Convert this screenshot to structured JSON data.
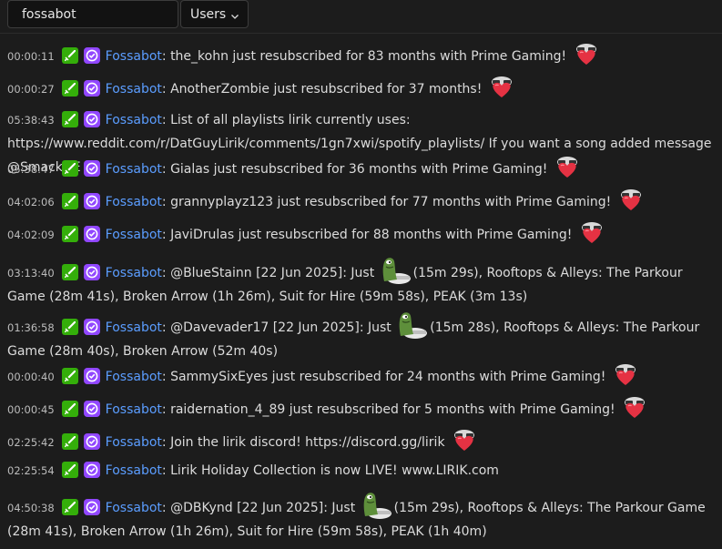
{
  "search": {
    "value": "fossabot",
    "placeholder": ""
  },
  "filter": {
    "label": "Users"
  },
  "icons": {
    "chevron": "chevron-down-icon",
    "moderator_badge": "sword-icon",
    "verified_badge": "verified-check-icon",
    "love_emote": "heart-emote",
    "frog_emote": "frog-emote"
  },
  "colors": {
    "username": "#5b9dff",
    "moderator_badge": "#34ae0a",
    "verified_badge": "#9147ff",
    "background": "#1c1c1c"
  },
  "messages": [
    {
      "time": "00:00:11",
      "user": "Fossabot",
      "text": "the_kohn just resubscribed for 83 months with Prime Gaming!",
      "emote": "heart"
    },
    {
      "time": "00:00:27",
      "user": "Fossabot",
      "text": "AnotherZombie just resubscribed for 37 months!",
      "emote": "heart"
    },
    {
      "time": "05:38:43",
      "user": "Fossabot",
      "text": "List of all playlists lirik currently uses: https://www.reddit.com/r/DatGuyLirik/comments/1gn7xwi/spotify_playlists/ If you want a song added message @SmackDE"
    },
    {
      "time": "05:38:47",
      "user": "Fossabot",
      "text": "Gialas just resubscribed for 36 months with Prime Gaming!",
      "emote": "heart"
    },
    {
      "time": "04:02:06",
      "user": "Fossabot",
      "text": "grannyplayz123 just resubscribed for 77 months with Prime Gaming!",
      "emote": "heart"
    },
    {
      "time": "04:02:09",
      "user": "Fossabot",
      "text": "JaviDrulas just resubscribed for 88 months with Prime Gaming!",
      "emote": "heart"
    },
    {
      "time": "03:13:40",
      "user": "Fossabot",
      "text_before": "@BlueStainn [22 Jun 2025]: Just",
      "emote_mid": "frog",
      "text_after": "(15m 29s), Rooftops & Alleys: The Parkour Game (28m 41s), Broken Arrow (1h 26m), Suit for Hire (59m 58s), PEAK (3m 13s)"
    },
    {
      "time": "01:36:58",
      "user": "Fossabot",
      "text_before": "@Davevader17 [22 Jun 2025]: Just",
      "emote_mid": "frog",
      "text_after": "(15m 28s), Rooftops & Alleys: The Parkour Game (28m 40s), Broken Arrow (52m 40s)"
    },
    {
      "time": "00:00:40",
      "user": "Fossabot",
      "text": "SammySixEyes just resubscribed for 24 months with Prime Gaming!",
      "emote": "heart"
    },
    {
      "time": "00:00:45",
      "user": "Fossabot",
      "text": "raidernation_4_89 just resubscribed for 5 months with Prime Gaming!",
      "emote": "heart"
    },
    {
      "time": "02:25:42",
      "user": "Fossabot",
      "text": "Join the lirik discord! https://discord.gg/lirik",
      "emote": "heart"
    },
    {
      "time": "02:25:54",
      "user": "Fossabot",
      "text": "Lirik Holiday Collection is now LIVE! www.LIRIK.com"
    },
    {
      "time": "04:50:38",
      "user": "Fossabot",
      "text_before": "@DBKynd [22 Jun 2025]: Just",
      "emote_mid": "frog",
      "text_after": "(15m 29s), Rooftops & Alleys: The Parkour Game (28m 41s), Broken Arrow (1h 26m), Suit for Hire (59m 58s), PEAK (1h 40m)"
    }
  ]
}
